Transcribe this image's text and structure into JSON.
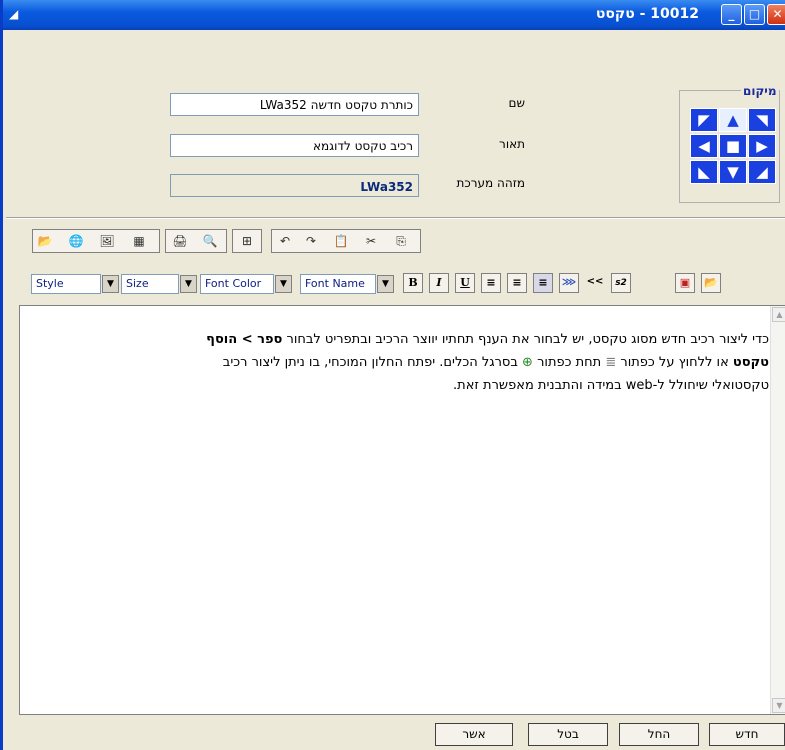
{
  "window": {
    "title": "10012 - טקסט",
    "minimize_glyph": "_",
    "maximize_glyph": "□",
    "close_glyph": "✕",
    "sys_glyph": "◢"
  },
  "form": {
    "name_label": "שם",
    "name_value": "כותרת טקסט חדשה LWa352",
    "desc_label": "תאור",
    "desc_value": "רכיב טקסט לדוגמא",
    "sysid_label": "מזהה מערכת",
    "sysid_value": "LWa352"
  },
  "position": {
    "label": "מיקום",
    "arrows": [
      "◤",
      "▲",
      "◥",
      "◀",
      "■",
      "▶",
      "◣",
      "▼",
      "◢"
    ]
  },
  "toolbar1": {
    "icons": [
      "📂",
      "🌐",
      "🖼",
      "▦",
      "🖨",
      "🔍",
      "⊞",
      "↶",
      "↷",
      "📋",
      "✂",
      "⎘"
    ]
  },
  "toolbar2": {
    "style_label": "Style",
    "size_label": "Size",
    "font_color_label": "Font Color",
    "font_name_label": "Font Name",
    "bold": "B",
    "italic": "I",
    "underline": "U",
    "align_left": "≡",
    "align_center": "≡",
    "align_right": "≡",
    "more_glyph": "⋙",
    "less_glyph": "<<",
    "sup_glyph": "s2",
    "save_glyph": "▣",
    "open_glyph": "📂"
  },
  "editor": {
    "line1_a": "כדי ליצור רכיב חדש מסוג טקסט, יש לבחור את הענף תחתיו יווצר הרכיב ובתפריט לבחור ",
    "line1_bold": "ספר > הוסף",
    "line2_bold": "טקסט",
    "line2_a": " או ללחוץ על כפתור ",
    "icon1": "≣",
    "line2_b": " תחת כפתור ",
    "icon2": "⊕",
    "line2_c": " בסרגל הכלים. יפתח החלון המוכחי, בו ניתן ליצור רכיב",
    "line3": "טקסטואלי שיחולל ל-web במידה והתבנית מאפשרת זאת."
  },
  "buttons": {
    "confirm": "אשר",
    "cancel": "בטל",
    "apply": "החל",
    "new": "חדש"
  }
}
